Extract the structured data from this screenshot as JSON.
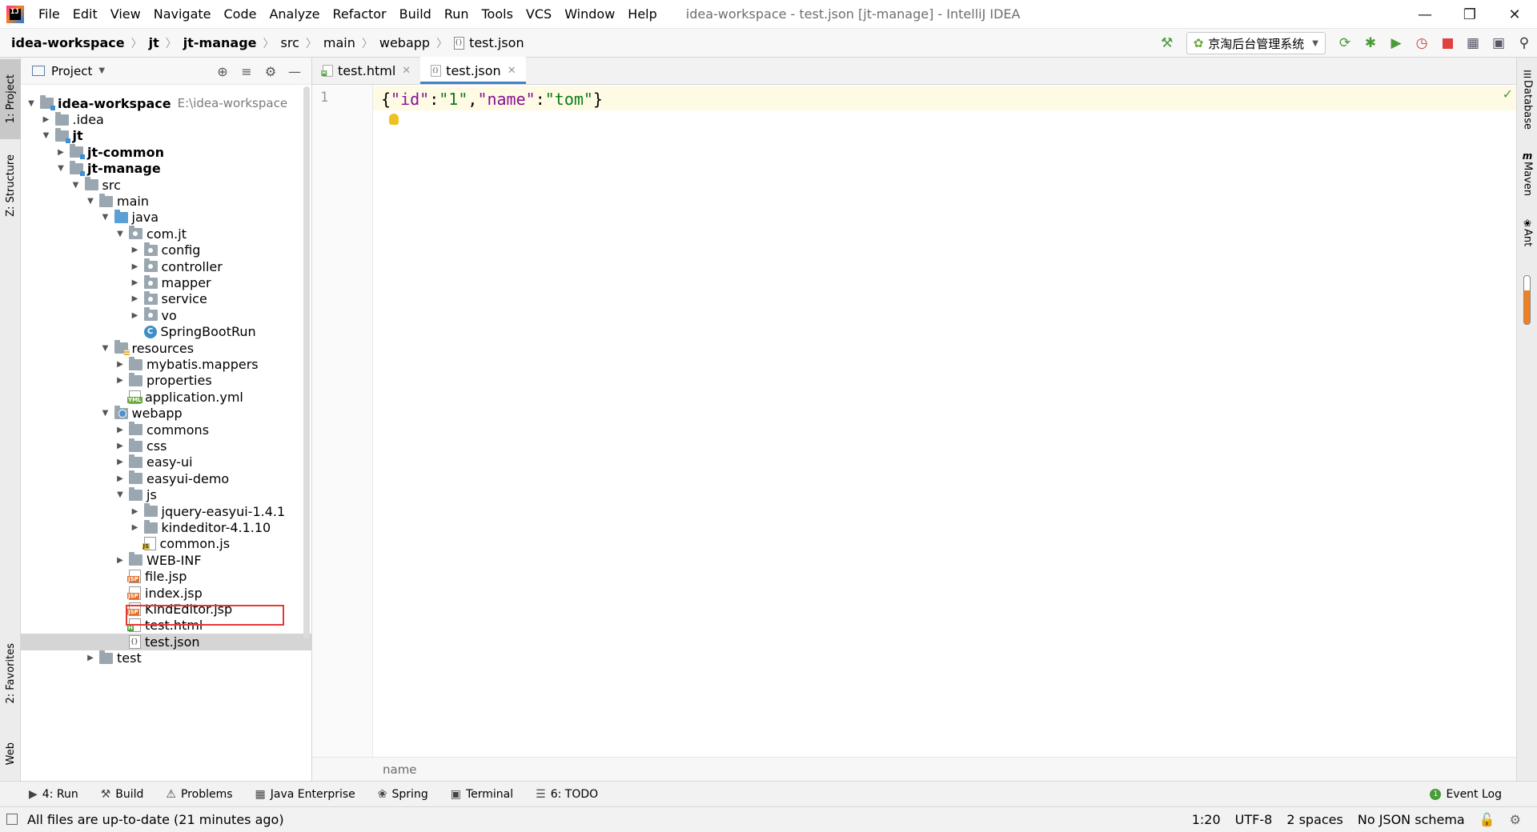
{
  "menu": [
    "File",
    "Edit",
    "View",
    "Navigate",
    "Code",
    "Analyze",
    "Refactor",
    "Build",
    "Run",
    "Tools",
    "VCS",
    "Window",
    "Help"
  ],
  "window_title": "idea-workspace - test.json [jt-manage] - IntelliJ IDEA",
  "breadcrumb": [
    "idea-workspace",
    "jt",
    "jt-manage",
    "src",
    "main",
    "webapp",
    "test.json"
  ],
  "run_config": "京淘后台管理系统",
  "left_tabs": {
    "project": "1: Project",
    "structure": "Z: Structure",
    "favorites": "2: Favorites",
    "web": "Web"
  },
  "right_tabs": {
    "database": "Database",
    "maven": "Maven",
    "ant": "Ant"
  },
  "project_panel": {
    "title": "Project"
  },
  "tree": [
    {
      "label": "idea-workspace",
      "hint": "E:\\idea-workspace",
      "depth": 0,
      "arrow": "open",
      "icon": "folder-module",
      "bold": true
    },
    {
      "label": ".idea",
      "depth": 1,
      "arrow": "closed",
      "icon": "folder"
    },
    {
      "label": "jt",
      "depth": 1,
      "arrow": "open",
      "icon": "folder-module",
      "bold": true
    },
    {
      "label": "jt-common",
      "depth": 2,
      "arrow": "closed",
      "icon": "folder-module",
      "bold": true
    },
    {
      "label": "jt-manage",
      "depth": 2,
      "arrow": "open",
      "icon": "folder-module",
      "bold": true
    },
    {
      "label": "src",
      "depth": 3,
      "arrow": "open",
      "icon": "folder"
    },
    {
      "label": "main",
      "depth": 4,
      "arrow": "open",
      "icon": "folder"
    },
    {
      "label": "java",
      "depth": 5,
      "arrow": "open",
      "icon": "folder-src"
    },
    {
      "label": "com.jt",
      "depth": 6,
      "arrow": "open",
      "icon": "folder-pkg"
    },
    {
      "label": "config",
      "depth": 7,
      "arrow": "closed",
      "icon": "folder-pkg"
    },
    {
      "label": "controller",
      "depth": 7,
      "arrow": "closed",
      "icon": "folder-pkg"
    },
    {
      "label": "mapper",
      "depth": 7,
      "arrow": "closed",
      "icon": "folder-pkg"
    },
    {
      "label": "service",
      "depth": 7,
      "arrow": "closed",
      "icon": "folder-pkg"
    },
    {
      "label": "vo",
      "depth": 7,
      "arrow": "closed",
      "icon": "folder-pkg"
    },
    {
      "label": "SpringBootRun",
      "depth": 7,
      "arrow": "none",
      "icon": "class"
    },
    {
      "label": "resources",
      "depth": 5,
      "arrow": "open",
      "icon": "folder-res"
    },
    {
      "label": "mybatis.mappers",
      "depth": 6,
      "arrow": "closed",
      "icon": "folder"
    },
    {
      "label": "properties",
      "depth": 6,
      "arrow": "closed",
      "icon": "folder"
    },
    {
      "label": "application.yml",
      "depth": 6,
      "arrow": "none",
      "icon": "file-yml"
    },
    {
      "label": "webapp",
      "depth": 5,
      "arrow": "open",
      "icon": "folder-web"
    },
    {
      "label": "commons",
      "depth": 6,
      "arrow": "closed",
      "icon": "folder"
    },
    {
      "label": "css",
      "depth": 6,
      "arrow": "closed",
      "icon": "folder"
    },
    {
      "label": "easy-ui",
      "depth": 6,
      "arrow": "closed",
      "icon": "folder"
    },
    {
      "label": "easyui-demo",
      "depth": 6,
      "arrow": "closed",
      "icon": "folder"
    },
    {
      "label": "js",
      "depth": 6,
      "arrow": "open",
      "icon": "folder"
    },
    {
      "label": "jquery-easyui-1.4.1",
      "depth": 7,
      "arrow": "closed",
      "icon": "folder"
    },
    {
      "label": "kindeditor-4.1.10",
      "depth": 7,
      "arrow": "closed",
      "icon": "folder"
    },
    {
      "label": "common.js",
      "depth": 7,
      "arrow": "none",
      "icon": "file-js"
    },
    {
      "label": "WEB-INF",
      "depth": 6,
      "arrow": "closed",
      "icon": "folder"
    },
    {
      "label": "file.jsp",
      "depth": 6,
      "arrow": "none",
      "icon": "file-jsp"
    },
    {
      "label": "index.jsp",
      "depth": 6,
      "arrow": "none",
      "icon": "file-jsp"
    },
    {
      "label": "KindEditor.jsp",
      "depth": 6,
      "arrow": "none",
      "icon": "file-jsp"
    },
    {
      "label": "test.html",
      "depth": 6,
      "arrow": "none",
      "icon": "file-html"
    },
    {
      "label": "test.json",
      "depth": 6,
      "arrow": "none",
      "icon": "file-json",
      "selected": true
    },
    {
      "label": "test",
      "depth": 4,
      "arrow": "closed",
      "icon": "folder"
    }
  ],
  "editor_tabs": [
    {
      "label": "test.html",
      "active": false,
      "icon": "file-html"
    },
    {
      "label": "test.json",
      "active": true,
      "icon": "file-json"
    }
  ],
  "editor": {
    "line_number": "1",
    "code_tokens": [
      {
        "t": "{",
        "c": "p"
      },
      {
        "t": "\"id\"",
        "c": "k"
      },
      {
        "t": ":",
        "c": "p"
      },
      {
        "t": "\"1\"",
        "c": "v"
      },
      {
        "t": ",",
        "c": "p"
      },
      {
        "t": "\"name\"",
        "c": "k"
      },
      {
        "t": ":",
        "c": "p"
      },
      {
        "t": "\"tom\"",
        "c": "v"
      },
      {
        "t": "}",
        "c": "p"
      }
    ],
    "breadcrumb": "name"
  },
  "bottom_tabs": [
    {
      "label": "4: Run",
      "icon": "run-icon"
    },
    {
      "label": "Build",
      "icon": "build-icon"
    },
    {
      "label": "Problems",
      "icon": "problems-icon"
    },
    {
      "label": "Java Enterprise",
      "icon": "java-enterprise-icon"
    },
    {
      "label": "Spring",
      "icon": "spring-icon"
    },
    {
      "label": "Terminal",
      "icon": "terminal-icon"
    },
    {
      "label": "6: TODO",
      "icon": "todo-icon"
    }
  ],
  "event_log": "Event Log",
  "status": {
    "message": "All files are up-to-date (21 minutes ago)",
    "position": "1:20",
    "encoding": "UTF-8",
    "indent": "2 spaces",
    "schema": "No JSON schema"
  },
  "colors": {
    "accent": "#4083c9",
    "selection_outline": "#e53935",
    "json_key": "#871094",
    "json_value": "#067d17"
  }
}
